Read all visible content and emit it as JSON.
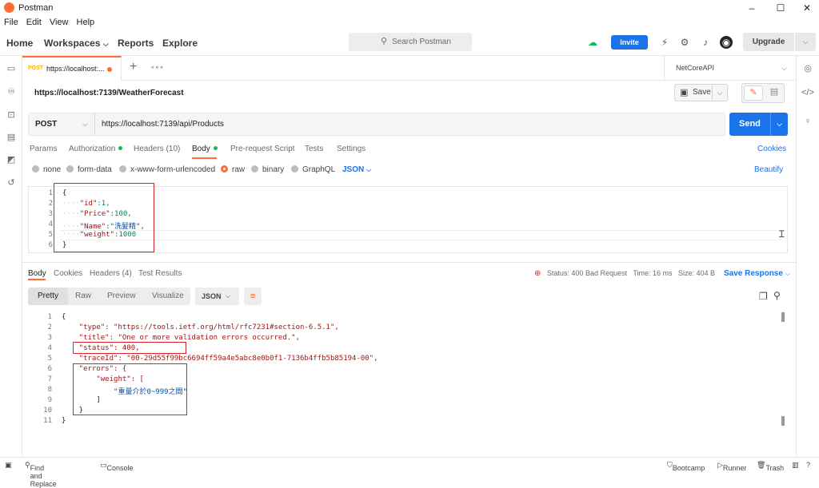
{
  "window": {
    "title": "Postman",
    "controls": [
      "–",
      "☐",
      "✕"
    ]
  },
  "menu": [
    "File",
    "Edit",
    "View",
    "Help"
  ],
  "header": {
    "nav": {
      "home": "Home",
      "workspaces": "Workspaces",
      "reports": "Reports",
      "explore": "Explore"
    },
    "search_placeholder": "Search Postman",
    "invite_label": "Invite",
    "upgrade_label": "Upgrade"
  },
  "tabs": [
    {
      "method": "POST",
      "url": "https://localhost:..."
    }
  ],
  "environment": "NetCoreAPI",
  "request": {
    "name": "https://localhost:7139/WeatherForecast",
    "save_label": "Save",
    "method": "POST",
    "url": "https://localhost:7139/api/Products",
    "send_label": "Send",
    "tabs": {
      "params": "Params",
      "authorization": "Authorization",
      "headers": "Headers (10)",
      "body": "Body",
      "prerequest": "Pre-request Script",
      "tests": "Tests",
      "settings": "Settings",
      "cookies": "Cookies"
    },
    "body_types": [
      "none",
      "form-data",
      "x-www-form-urlencoded",
      "raw",
      "binary",
      "GraphQL"
    ],
    "body_format": "JSON",
    "beautify": "Beautify",
    "body_lines": [
      {
        "n": "1",
        "text": "{"
      },
      {
        "n": "2",
        "ws": "····",
        "key": "\"id\"",
        "val": ":1,",
        "type": "num"
      },
      {
        "n": "3",
        "ws": "····",
        "key": "\"Price\"",
        "val": ":100,",
        "type": "num"
      },
      {
        "n": "4",
        "ws": "····",
        "key": "\"Name\"",
        "val": ":\"洗髮精\",",
        "type": "str"
      },
      {
        "n": "5",
        "ws": "····",
        "key": "\"weight\"",
        "val": ":1000",
        "type": "num"
      },
      {
        "n": "6",
        "text": "}"
      }
    ]
  },
  "response": {
    "tabs": {
      "body": "Body",
      "cookies": "Cookies",
      "headers": "Headers (4)",
      "tests": "Test Results"
    },
    "status_text": "Status: 400 Bad Request",
    "time_text": "Time: 16 ms",
    "size_text": "Size: 404 B",
    "save_response": "Save Response",
    "views": {
      "pretty": "Pretty",
      "raw": "Raw",
      "preview": "Preview",
      "visualize": "Visualize"
    },
    "format": "JSON",
    "lines": [
      {
        "n": "1",
        "text": "{"
      },
      {
        "n": "2",
        "text": "    \"type\": \"https://tools.ietf.org/html/rfc7231#section-6.5.1\","
      },
      {
        "n": "3",
        "text": "    \"title\": \"One or more validation errors occurred.\","
      },
      {
        "n": "4",
        "text": "    \"status\": 400,"
      },
      {
        "n": "5",
        "text": "    \"traceId\": \"00-29d55f99bc6694ff59a4e5abc8e0b0f1-7136b4ffb5b85194-00\","
      },
      {
        "n": "6",
        "text": "    \"errors\": {"
      },
      {
        "n": "7",
        "text": "        \"weight\": ["
      },
      {
        "n": "8",
        "text": "            \"重量介於0~999之間\""
      },
      {
        "n": "9",
        "text": "        ]"
      },
      {
        "n": "10",
        "text": "    }"
      },
      {
        "n": "11",
        "text": "}"
      }
    ]
  },
  "footer": {
    "find_replace": "Find and Replace",
    "console": "Console",
    "bootcamp": "Bootcamp",
    "runner": "Runner",
    "trash": "Trash"
  },
  "colors": {
    "accent": "#ff6c37",
    "primary": "#1a73e8",
    "highlight_box": "#d9232a",
    "auth_dot": "#0cbb52"
  }
}
